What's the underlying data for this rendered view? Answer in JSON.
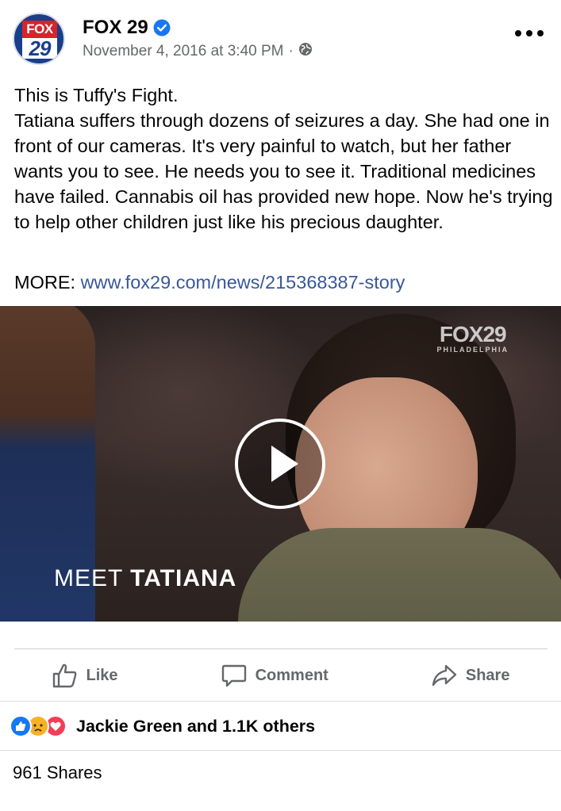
{
  "header": {
    "avatar_top": "FOX",
    "avatar_bottom": "29",
    "page_name": "FOX 29",
    "timestamp": "November 4, 2016 at 3:40 PM",
    "separator": "·"
  },
  "post": {
    "text_lines": [
      "This is Tuffy's Fight.",
      "Tatiana suffers through dozens of seizures a day. She had one in front of our cameras. It's very painful to watch, but her father wants you to see. He needs you to see it. Traditional medicines have failed. Cannabis oil has provided new hope. Now he's trying to help other children just like his precious daughter."
    ],
    "more_label": "MORE:",
    "more_link": "www.fox29.com/news/215368387-story"
  },
  "video": {
    "watermark_main": "FOX29",
    "watermark_sub": "PHILADELPHIA",
    "caption_light": "MEET ",
    "caption_bold": "TATIANA"
  },
  "actions": {
    "like": "Like",
    "comment": "Comment",
    "share": "Share"
  },
  "engagement": {
    "reactors": "Jackie Green and 1.1K others",
    "shares": "961 Shares"
  },
  "colors": {
    "link": "#385898",
    "verified": "#1877f2",
    "like_reaction": "#1877f2",
    "love_reaction": "#f33e58",
    "sad_reaction": "#f7b125"
  }
}
